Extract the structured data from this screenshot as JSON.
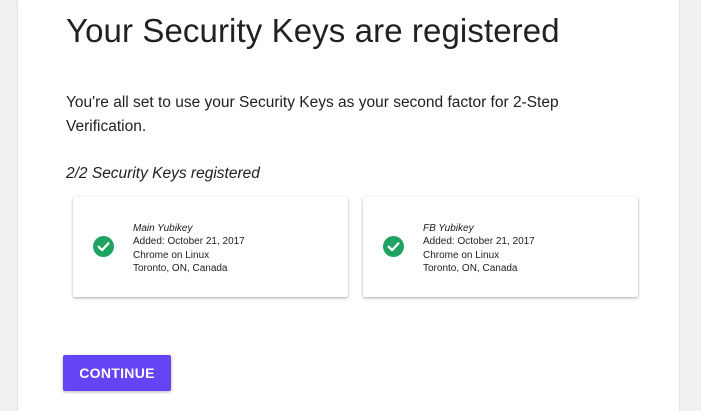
{
  "page": {
    "title": "Your Security Keys are registered",
    "description": "You're all set to use your Security Keys as your second factor for 2-Step Verification.",
    "registered_count": "2/2 Security Keys registered"
  },
  "keys": [
    {
      "name": "Main Yubikey",
      "added": "Added: October 21, 2017",
      "browser": "Chrome on Linux",
      "location": "Toronto, ON, Canada",
      "status_icon": "check-circle-icon"
    },
    {
      "name": "FB Yubikey",
      "added": "Added: October 21, 2017",
      "browser": "Chrome on Linux",
      "location": "Toronto, ON, Canada",
      "status_icon": "check-circle-icon"
    }
  ],
  "actions": {
    "continue_label": "CONTINUE"
  },
  "colors": {
    "accent": "#6444f5",
    "success": "#1ea362",
    "text": "#212121",
    "background": "#f1f1f1"
  }
}
